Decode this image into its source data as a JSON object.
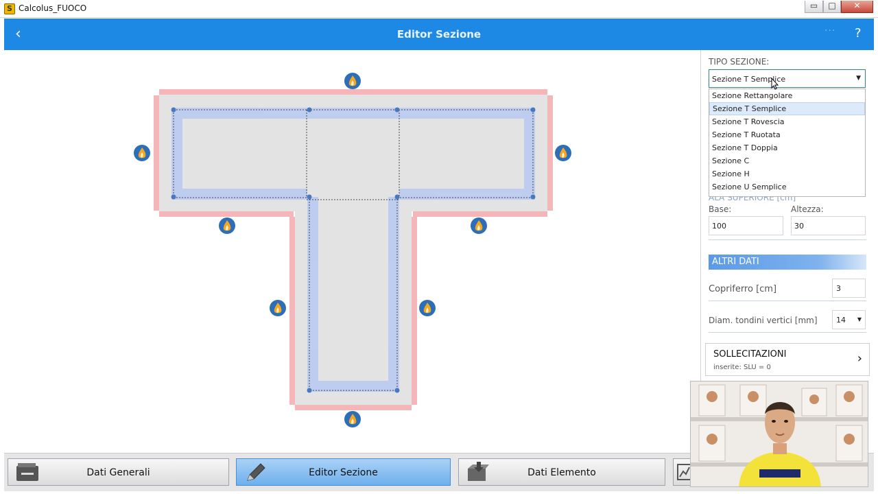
{
  "window": {
    "title": "Calcolus_FUOCO",
    "min_glyph": "▭",
    "max_glyph": "□",
    "close_glyph": "✕",
    "icon_letter": "S"
  },
  "header": {
    "title": "Editor Sezione",
    "back_glyph": "‹",
    "more_glyph": "···",
    "help_glyph": "?",
    "bg_color": "#1e88e5"
  },
  "panel": {
    "tipo_label": "TIPO SEZIONE:",
    "selected": "Sezione T Semplice",
    "options": [
      "Sezione Rettangolare",
      "Sezione T Semplice",
      "Sezione T Rovescia",
      "Sezione T Ruotata",
      "Sezione T Doppia",
      "Sezione C",
      "Sezione H",
      "Sezione U Semplice"
    ],
    "selected_option": "Sezione T Semplice",
    "ala_label": "ALA SUPERIORE [cm]",
    "base_label": "Base:",
    "base_value": "100",
    "altezza_label": "Altezza:",
    "altezza_value": "30",
    "altri_dati": "ALTRI DATI",
    "copriferro_label": "Copriferro [cm]",
    "copriferro_value": "3",
    "diam_label": "Diam. tondini vertici [mm]",
    "diam_value": "14",
    "sollecitazioni_title": "SOLLECITAZIONI",
    "sollecitazioni_sub": "inserite: SLU = 0",
    "chevron_glyph": "›"
  },
  "bottom": {
    "tabs": [
      {
        "label": "Dati Generali",
        "icon": "folder-icon",
        "active": false
      },
      {
        "label": "Editor Sezione",
        "icon": "pencil-icon",
        "active": true
      },
      {
        "label": "Dati Elemento",
        "icon": "element-icon",
        "active": false
      }
    ]
  },
  "colors": {
    "fire_exposure": "#f4b6b8",
    "rebar_zone": "#b7c9f2",
    "section_fill": "#e3e3e3",
    "fire_icon_bg": "#2c6fb8",
    "flame": "#f5a623"
  }
}
